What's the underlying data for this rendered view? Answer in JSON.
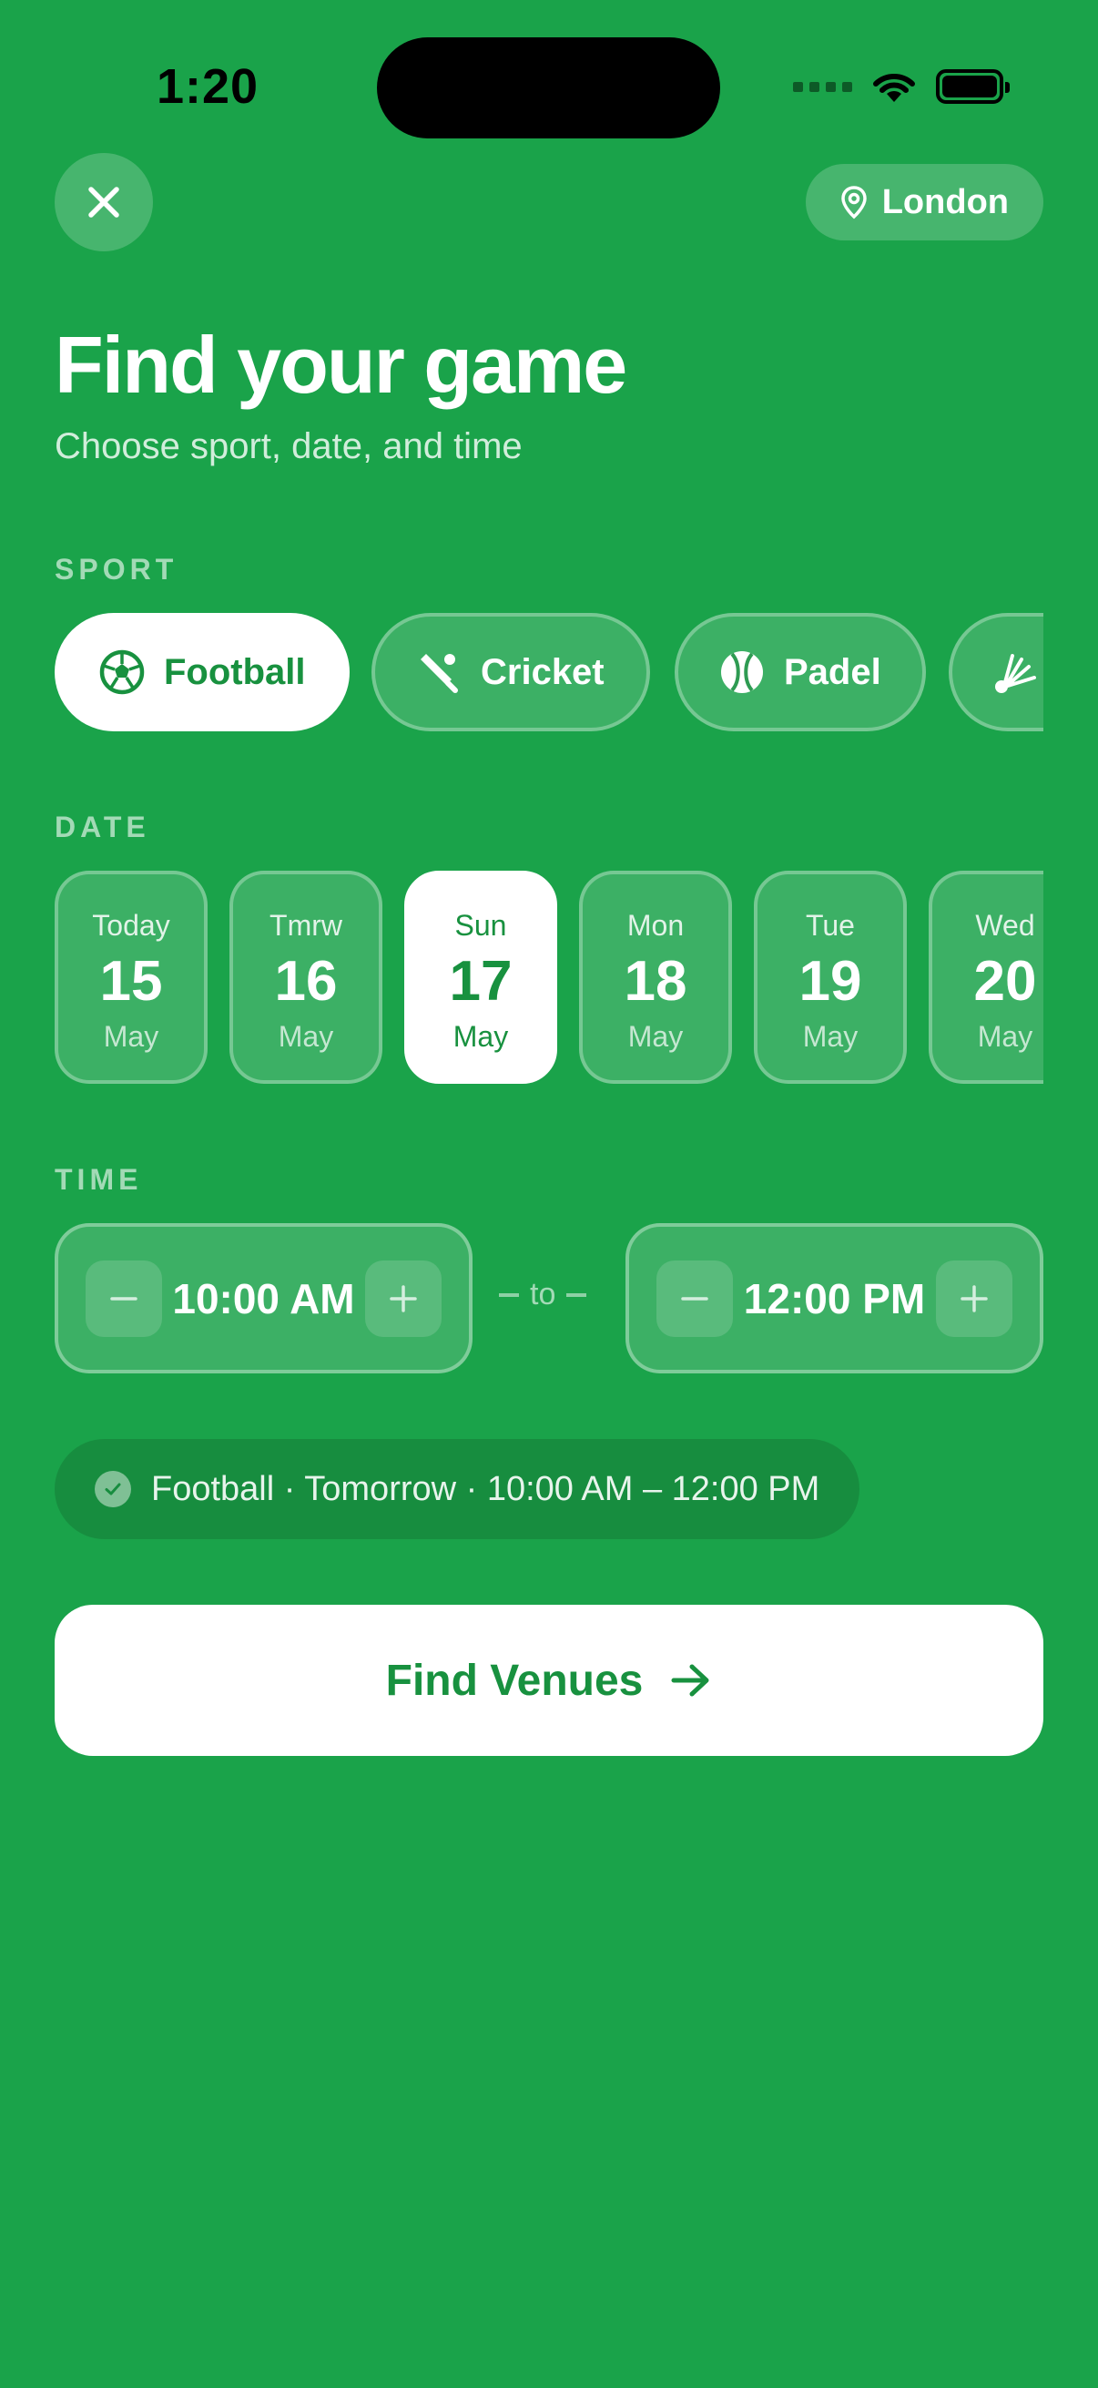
{
  "status_bar": {
    "time": "1:20"
  },
  "header": {
    "location": "London"
  },
  "title": "Find your game",
  "subtitle": "Choose sport, date, and time",
  "sport": {
    "label": "SPORT",
    "items": [
      {
        "label": "Football",
        "icon": "football-icon",
        "selected": true
      },
      {
        "label": "Cricket",
        "icon": "cricket-icon",
        "selected": false
      },
      {
        "label": "Padel",
        "icon": "padel-ball-icon",
        "selected": false
      },
      {
        "label": "",
        "icon": "badminton-shuttlecock-icon",
        "selected": false
      }
    ]
  },
  "date": {
    "label": "DATE",
    "items": [
      {
        "day": "Today",
        "num": "15",
        "month": "May",
        "selected": false
      },
      {
        "day": "Tmrw",
        "num": "16",
        "month": "May",
        "selected": false
      },
      {
        "day": "Sun",
        "num": "17",
        "month": "May",
        "selected": true
      },
      {
        "day": "Mon",
        "num": "18",
        "month": "May",
        "selected": false
      },
      {
        "day": "Tue",
        "num": "19",
        "month": "May",
        "selected": false
      },
      {
        "day": "Wed",
        "num": "20",
        "month": "May",
        "selected": false
      }
    ]
  },
  "time": {
    "label": "TIME",
    "start": "10:00 AM",
    "end": "12:00 PM",
    "separator": "to"
  },
  "summary": {
    "text": "Football · Tomorrow · 10:00 AM – 12:00 PM"
  },
  "cta": {
    "label": "Find Venues"
  },
  "colors": {
    "background": "#1aa34a",
    "accent": "#18913f",
    "summary_bg": "#178d3f"
  }
}
